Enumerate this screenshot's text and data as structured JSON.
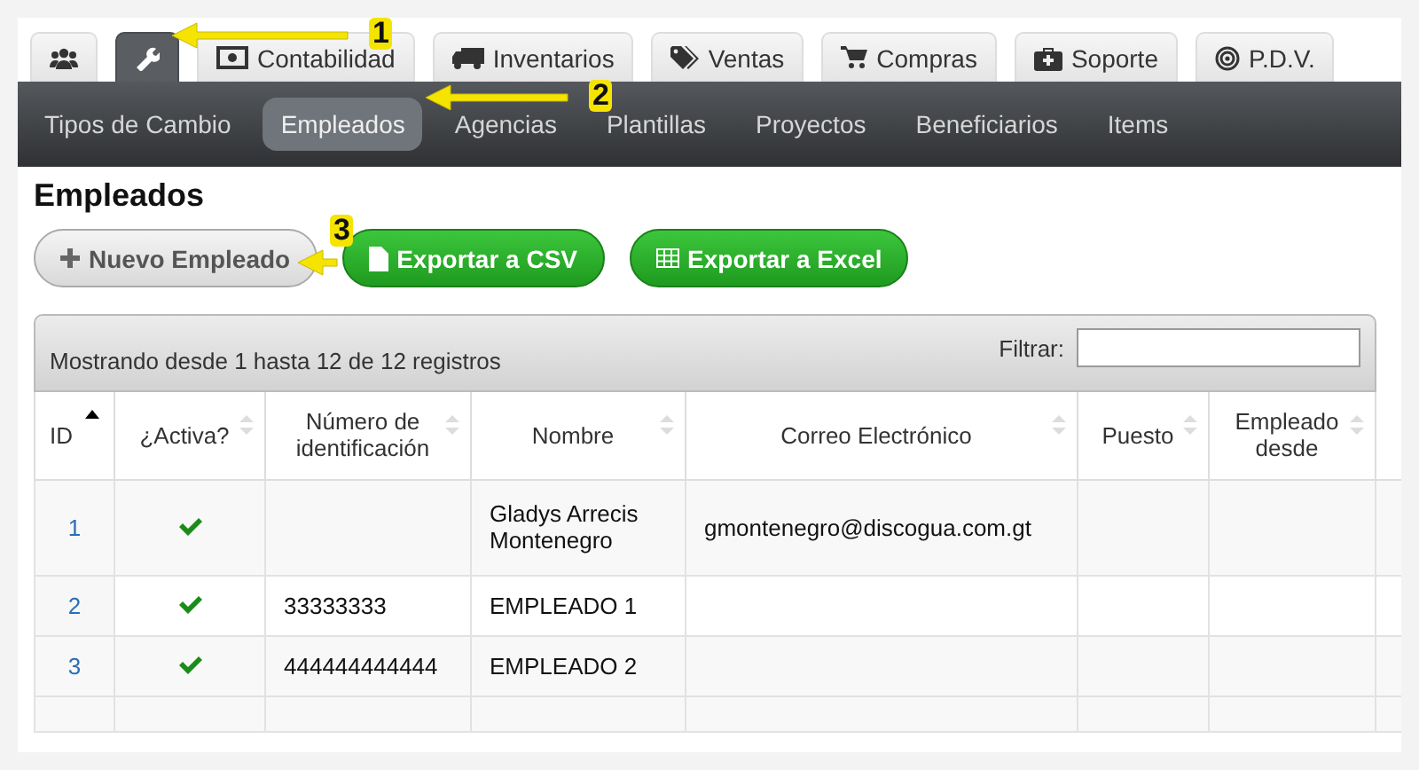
{
  "tabs": [
    {
      "selected": false
    },
    {
      "selected": true
    },
    {
      "label": "Contabilidad",
      "selected": false
    },
    {
      "label": "Inventarios",
      "selected": false
    },
    {
      "label": "Ventas",
      "selected": false
    },
    {
      "label": "Compras",
      "selected": false
    },
    {
      "label": "Soporte",
      "selected": false
    },
    {
      "label": "P.D.V.",
      "selected": false
    }
  ],
  "subnav": [
    {
      "label": "Tipos de Cambio",
      "selected": false
    },
    {
      "label": "Empleados",
      "selected": true
    },
    {
      "label": "Agencias",
      "selected": false
    },
    {
      "label": "Plantillas",
      "selected": false
    },
    {
      "label": "Proyectos",
      "selected": false
    },
    {
      "label": "Beneficiarios",
      "selected": false
    },
    {
      "label": "Items",
      "selected": false
    }
  ],
  "heading": "Empleados",
  "buttons": [
    {
      "kind": "default",
      "label": "Nuevo Empleado"
    },
    {
      "kind": "success",
      "label": "Exportar a CSV"
    },
    {
      "kind": "success",
      "label": "Exportar a Excel"
    }
  ],
  "table": {
    "info": "Mostrando desde 1 hasta 12 de 12 registros",
    "filter_label": "Filtrar:",
    "columns": [
      {
        "label": "ID",
        "sorted": true
      },
      {
        "label": "¿Activa?",
        "sorted": false
      },
      {
        "label": "Número de identificación",
        "sorted": false
      },
      {
        "label": "Nombre",
        "sorted": false
      },
      {
        "label": "Correo Electrónico",
        "sorted": false
      },
      {
        "label": "Puesto",
        "sorted": false
      },
      {
        "label": "Empleado desde",
        "sorted": false
      }
    ],
    "rows": [
      {
        "id": "1",
        "active": true,
        "name": "Gladys Arrecis Montenegro",
        "email": "gmontenegro@discogua.com.gt"
      },
      {
        "id": "2",
        "active": true,
        "id_number": "33333333",
        "name": "EMPLEADO 1"
      },
      {
        "id": "3",
        "active": true,
        "id_number": "444444444444",
        "name": "EMPLEADO 2"
      }
    ]
  },
  "callouts": [
    {
      "label": "1"
    },
    {
      "label": "2"
    },
    {
      "label": "3"
    }
  ]
}
